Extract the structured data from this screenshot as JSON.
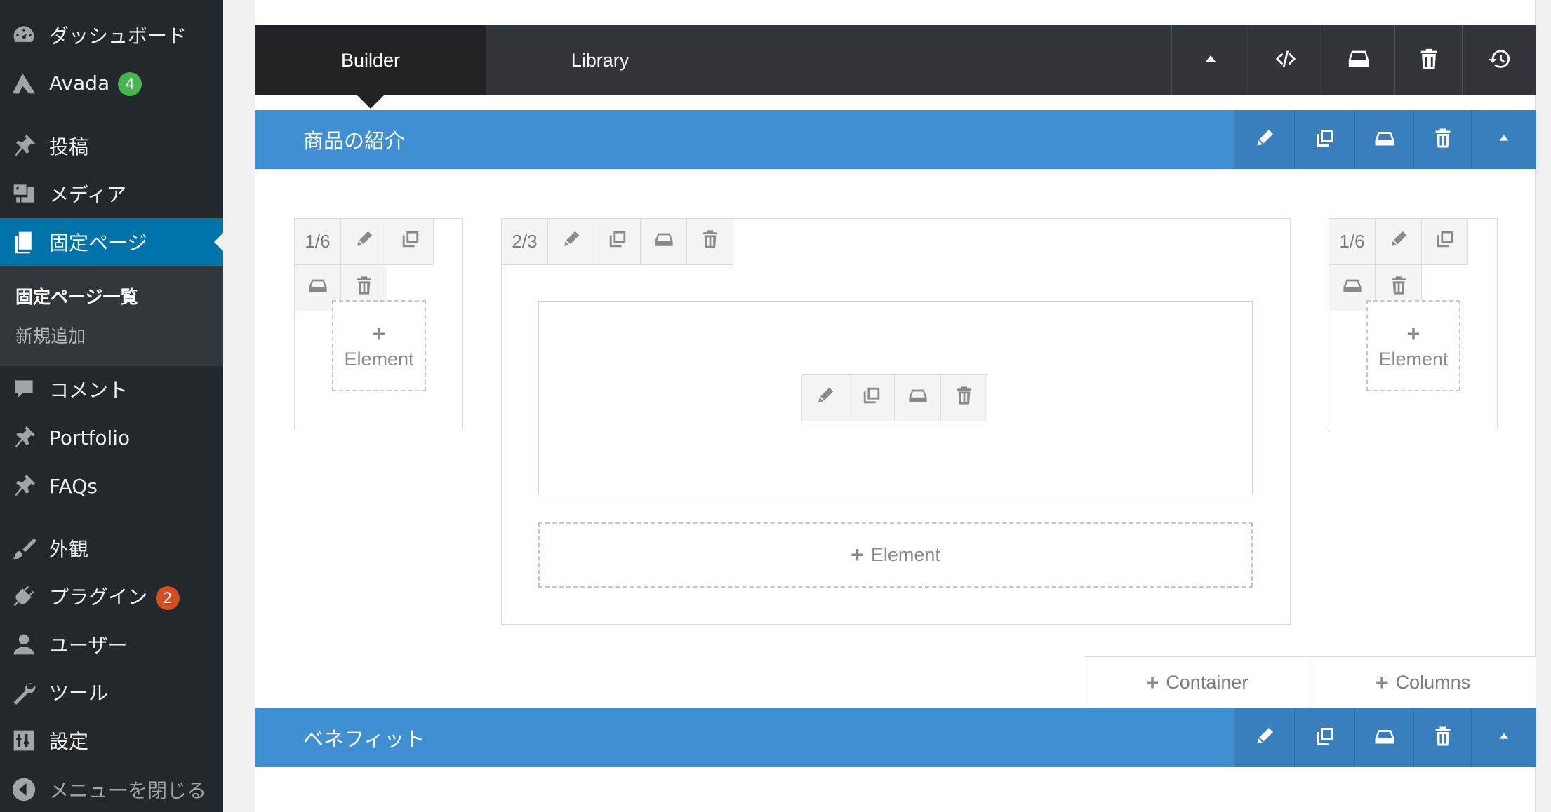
{
  "sidebar": {
    "items": [
      {
        "label": "ダッシュボード",
        "icon": "dashboard-icon"
      },
      {
        "label": "Avada",
        "icon": "avada-logo-icon",
        "badge": "4",
        "badge_color": "#46b450"
      },
      {
        "label": "投稿",
        "icon": "pushpin-icon"
      },
      {
        "label": "メディア",
        "icon": "media-icon"
      },
      {
        "label": "固定ページ",
        "icon": "pages-icon"
      },
      {
        "label": "コメント",
        "icon": "comment-icon"
      },
      {
        "label": "Portfolio",
        "icon": "pushpin-icon"
      },
      {
        "label": "FAQs",
        "icon": "pushpin-icon"
      },
      {
        "label": "外観",
        "icon": "paintbrush-icon"
      },
      {
        "label": "プラグイン",
        "icon": "plugin-icon",
        "badge": "2",
        "badge_color": "#d54e21"
      },
      {
        "label": "ユーザー",
        "icon": "user-icon"
      },
      {
        "label": "ツール",
        "icon": "wrench-icon"
      },
      {
        "label": "設定",
        "icon": "settings-icon"
      }
    ],
    "submenu": [
      "固定ページ一覧",
      "新規追加"
    ],
    "collapse_label": "メニューを閉じる",
    "accent": "#0073aa",
    "background": "#23282d"
  },
  "builder": {
    "tabs": [
      "Builder",
      "Library"
    ],
    "toolbar_icons": [
      "collapse-up-icon",
      "code-icon",
      "save-icon",
      "trash-icon",
      "history-icon"
    ],
    "header_color": "#418fd3"
  },
  "sections": [
    {
      "title": "商品の紹介",
      "columns": [
        {
          "size": "1/6",
          "add_label": "Element"
        },
        {
          "size": "2/3",
          "add_label": "Element"
        },
        {
          "size": "1/6",
          "add_label": "Element"
        }
      ]
    },
    {
      "title": "ベネフィット"
    }
  ],
  "actions": {
    "container_label": "Container",
    "columns_label": "Columns"
  }
}
